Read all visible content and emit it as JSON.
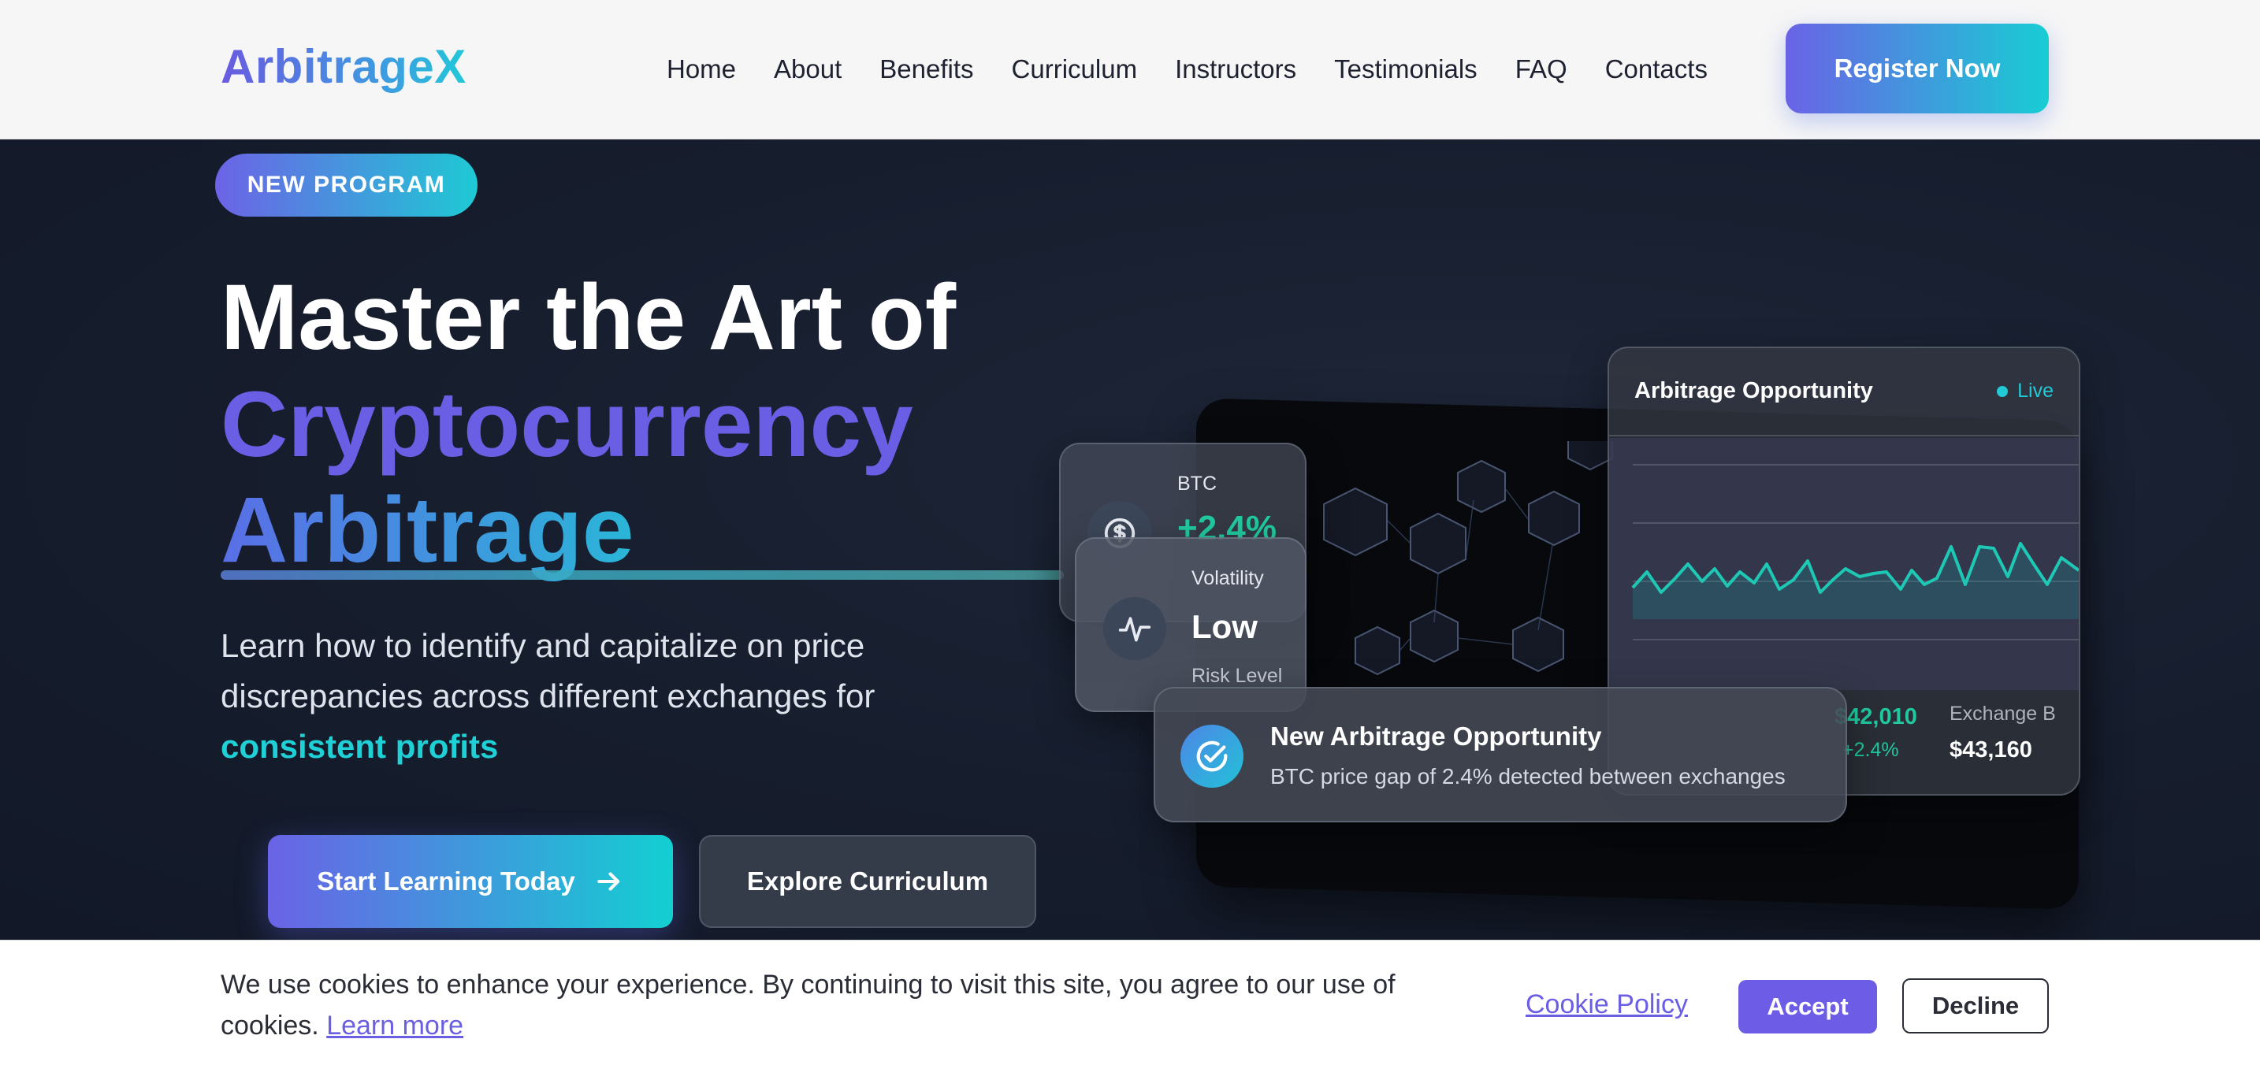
{
  "header": {
    "logo": "ArbitrageX",
    "nav": [
      "Home",
      "About",
      "Benefits",
      "Curriculum",
      "Instructors",
      "Testimonials",
      "FAQ",
      "Contacts"
    ],
    "register_label": "Register Now"
  },
  "hero": {
    "badge": "NEW PROGRAM",
    "title_line1": "Master the Art of",
    "title_line2": "Cryptocurrency",
    "title_line3": "Arbitrage",
    "description": "Learn how to identify and capitalize on price discrepancies across different exchanges for",
    "description_highlight": "consistent profits",
    "primary_button": "Start Learning Today",
    "secondary_button": "Explore Curriculum"
  },
  "btc_card": {
    "label": "BTC",
    "value": "+2.4%"
  },
  "volatility_card": {
    "label": "Volatility",
    "value": "Low",
    "sub": "Risk Level"
  },
  "arbitrage_card": {
    "title": "Arbitrage Opportunity",
    "status": "Live",
    "exchange_a_price": "$42,010",
    "exchange_a_change": "+2.4%",
    "exchange_b_label": "Exchange B",
    "exchange_b_price": "$43,160"
  },
  "notification": {
    "title": "New Arbitrage Opportunity",
    "message": "BTC price gap of 2.4% detected between exchanges"
  },
  "cookie": {
    "text": "We use cookies to enhance your experience. By continuing to visit this site, you agree to our use of cookies.",
    "learn_more": "Learn more",
    "policy": "Cookie Policy",
    "accept": "Accept",
    "decline": "Decline"
  },
  "colors": {
    "accent_purple": "#6a5fe4",
    "accent_teal": "#1fd0d6",
    "positive_green": "#20c9a0",
    "hero_bg": "#161d2d"
  }
}
